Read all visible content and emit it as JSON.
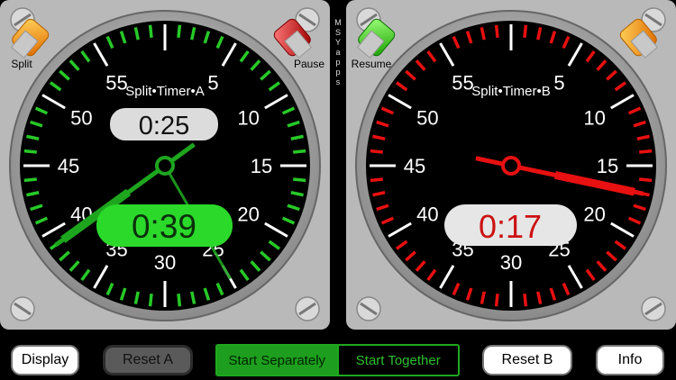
{
  "timer_a": {
    "title": "Split•Timer•A",
    "split_label": "Split",
    "pause_label": "Pause",
    "split_time": "0:25",
    "main_time": "0:39",
    "tick_color": "#27c927",
    "hand_color": "#1ea51e",
    "display_bg": "#2bd92b",
    "seconds_value": 39,
    "split_seconds_value": 25
  },
  "timer_b": {
    "title": "Split•Timer•B",
    "resume_label": "Resume",
    "main_time": "0:17",
    "tick_color": "#e81010",
    "hand_color": "#e81010",
    "display_bg": "#e6e6e6",
    "display_text_color": "#cc1111",
    "seconds_value": 17
  },
  "dial_numbers": [
    "55",
    "5",
    "50",
    "10",
    "45",
    "15",
    "40",
    "20",
    "35",
    "25",
    "30"
  ],
  "vendor_letters": [
    "M",
    "S",
    "Y",
    "a",
    "p",
    "p",
    "s"
  ],
  "buttons": {
    "display": "Display",
    "reset_a": "Reset A",
    "start_separately": "Start Separately",
    "start_together": "Start Together",
    "reset_b": "Reset B",
    "info": "Info"
  }
}
